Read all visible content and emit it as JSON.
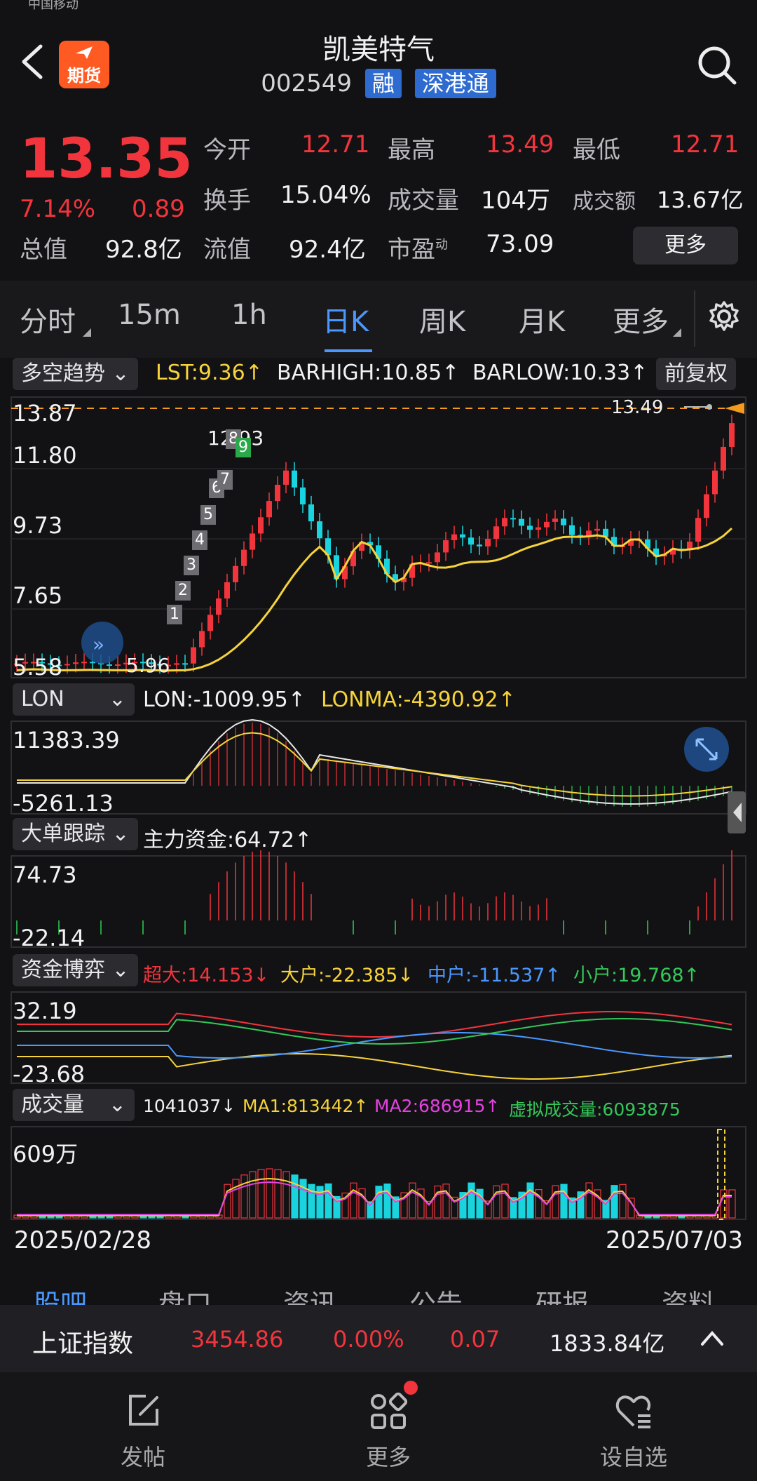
{
  "status_bar": {
    "carrier": "中国移动"
  },
  "header": {
    "title": "凯美特气",
    "code": "002549",
    "tags": [
      "融",
      "深港通"
    ],
    "brand": "期货"
  },
  "quote": {
    "price": "13.35",
    "change_pct": "7.14%",
    "change": "0.89",
    "open_label": "今开",
    "open": "12.71",
    "high_label": "最高",
    "high": "13.49",
    "low_label": "最低",
    "low": "12.71",
    "turnover_label": "换手",
    "turnover": "15.04%",
    "volume_label": "成交量",
    "volume": "104万",
    "amount_label": "成交额",
    "amount": "13.67亿",
    "mktcap_label": "总值",
    "mktcap": "92.8亿",
    "float_label": "流值",
    "float_cap": "92.4亿",
    "pe_label": "市盈",
    "pe_sup": "动",
    "pe": "73.09",
    "more_label": "更多"
  },
  "tabs": [
    "分时",
    "15m",
    "1h",
    "日K",
    "周K",
    "月K",
    "更多"
  ],
  "kline": {
    "indicator": "多空趋势",
    "lst": "LST:9.36↑",
    "barhigh": "BARHIGH:10.85↑",
    "barlow": "BARLOW:10.33↑",
    "adjust": "前复权",
    "axis": [
      "13.87",
      "11.80",
      "9.73",
      "7.65",
      "5.58"
    ],
    "high_mark": "13.49",
    "peak_mark": "12.93",
    "low_mark": "5.96",
    "signals": [
      "1",
      "2",
      "3",
      "4",
      "5",
      "6",
      "7",
      "8",
      "9"
    ]
  },
  "lon": {
    "indicator": "LON",
    "lon": "LON:-1009.95↑",
    "lonma": "LONMA:-4390.92↑",
    "axis": [
      "11383.39",
      "-5261.13"
    ]
  },
  "bigorder": {
    "indicator": "大单跟踪",
    "main": "主力资金:64.72↑",
    "axis": [
      "74.73",
      "-22.14"
    ]
  },
  "game": {
    "indicator": "资金博弈",
    "super": "超大:14.153↓",
    "big": "大户:-22.385↓",
    "mid": "中户:-11.537↑",
    "small": "小户:19.768↑",
    "axis": [
      "32.19",
      "-23.68"
    ]
  },
  "vol": {
    "indicator": "成交量",
    "v": "1041037↓",
    "ma1": "MA1:813442↑",
    "ma2": "MA2:686915↑",
    "virtual": "虚拟成交量:6093875",
    "axis": "609万"
  },
  "dates": {
    "start": "2025/02/28",
    "end": "2025/07/03"
  },
  "section_tabs": [
    "股吧",
    "盘口",
    "资讯",
    "公告",
    "研报",
    "资料"
  ],
  "index_bar": {
    "name": "上证指数",
    "value": "3454.86",
    "pct": "0.00%",
    "change": "0.07",
    "amount": "1833.84亿"
  },
  "bottom_nav": [
    {
      "label": "发帖",
      "icon": "edit-icon"
    },
    {
      "label": "更多",
      "icon": "grid-icon"
    },
    {
      "label": "设自选",
      "icon": "heart-list-icon"
    }
  ],
  "colors": {
    "up": "#f2353d",
    "down": "#19d4de",
    "bg": "#121214",
    "accent": "#4a98ff"
  }
}
